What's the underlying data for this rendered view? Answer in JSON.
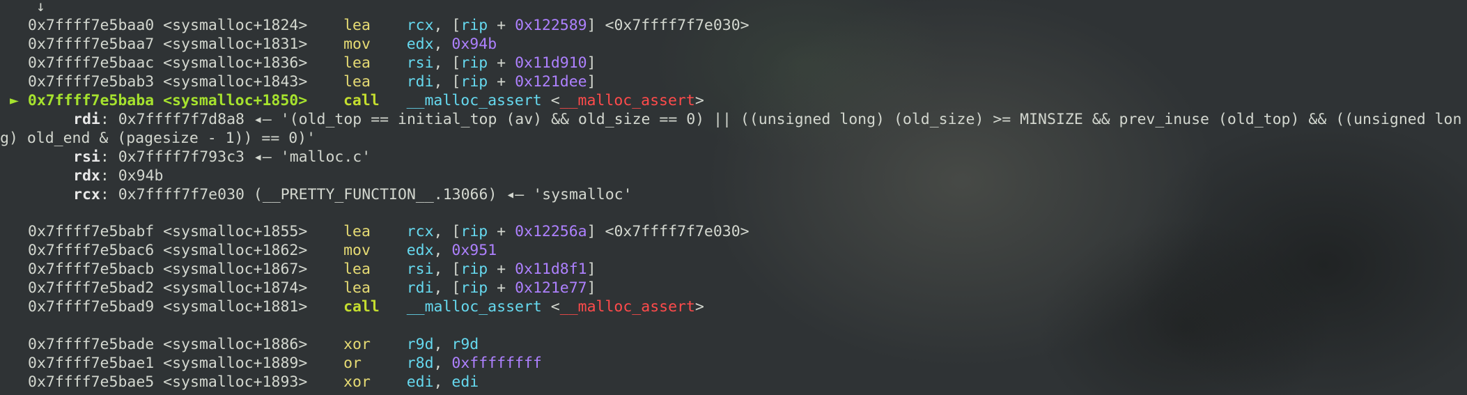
{
  "terminal": {
    "branch_arrow": "↓",
    "block1": [
      {
        "addr": "0x7ffff7e5baa0",
        "sym": "<sysmalloc+1824>",
        "mnemonic": "lea",
        "op_reg": "rcx",
        "op_base": "rip",
        "op_imm": "0x122589",
        "comment": " <0x7ffff7f7e030>"
      },
      {
        "addr": "0x7ffff7e5baa7",
        "sym": "<sysmalloc+1831>",
        "mnemonic": "mov",
        "op_reg": "edx",
        "op_imm": "0x94b"
      },
      {
        "addr": "0x7ffff7e5baac",
        "sym": "<sysmalloc+1836>",
        "mnemonic": "lea",
        "op_reg": "rsi",
        "op_base": "rip",
        "op_imm": "0x11d910"
      },
      {
        "addr": "0x7ffff7e5bab3",
        "sym": "<sysmalloc+1843>",
        "mnemonic": "lea",
        "op_reg": "rdi",
        "op_base": "rip",
        "op_imm": "0x121dee"
      }
    ],
    "current": {
      "marker": "►",
      "addr": "0x7ffff7e5baba",
      "sym": "<sysmalloc+1850>",
      "mnemonic": "call",
      "target": "__malloc_assert",
      "target_sym": "__malloc_assert"
    },
    "args": {
      "rdi_name": "rdi",
      "rdi_value": "0x7ffff7f7d8a8",
      "rdi_string_1": "'(old_top == initial_top (av) && old_size == 0) || ((unsigned long) (old_size) >= MINSIZE && prev_inuse (old_top) && ((unsigned lon",
      "rdi_string_2": "g) old_end & (pagesize - 1)) == 0)'",
      "rsi_name": "rsi",
      "rsi_value": "0x7ffff7f793c3",
      "rsi_string": "'malloc.c'",
      "rdx_name": "rdx",
      "rdx_value": "0x94b",
      "rcx_name": "rcx",
      "rcx_value": "0x7ffff7f7e030 (__PRETTY_FUNCTION__.13066)",
      "rcx_string": "'sysmalloc'",
      "arrow": "◂—"
    },
    "block2": [
      {
        "addr": "0x7ffff7e5babf",
        "sym": "<sysmalloc+1855>",
        "mnemonic": "lea",
        "op_reg": "rcx",
        "op_base": "rip",
        "op_imm": "0x12256a",
        "comment": " <0x7ffff7f7e030>"
      },
      {
        "addr": "0x7ffff7e5bac6",
        "sym": "<sysmalloc+1862>",
        "mnemonic": "mov",
        "op_reg": "edx",
        "op_imm": "0x951"
      },
      {
        "addr": "0x7ffff7e5bacb",
        "sym": "<sysmalloc+1867>",
        "mnemonic": "lea",
        "op_reg": "rsi",
        "op_base": "rip",
        "op_imm": "0x11d8f1"
      },
      {
        "addr": "0x7ffff7e5bad2",
        "sym": "<sysmalloc+1874>",
        "mnemonic": "lea",
        "op_reg": "rdi",
        "op_base": "rip",
        "op_imm": "0x121e77"
      }
    ],
    "call2": {
      "addr": "0x7ffff7e5bad9",
      "sym": "<sysmalloc+1881>",
      "mnemonic": "call",
      "target": "__malloc_assert",
      "target_sym": "__malloc_assert"
    },
    "block3": [
      {
        "addr": "0x7ffff7e5bade",
        "sym": "<sysmalloc+1886>",
        "mnemonic": "xor",
        "op_a": "r9d",
        "op_b": "r9d",
        "op_b_kind": "reg"
      },
      {
        "addr": "0x7ffff7e5bae1",
        "sym": "<sysmalloc+1889>",
        "mnemonic": "or",
        "op_a": "r8d",
        "op_b": "0xffffffff",
        "op_b_kind": "imm"
      },
      {
        "addr": "0x7ffff7e5bae5",
        "sym": "<sysmalloc+1893>",
        "mnemonic": "xor",
        "op_a": "edi",
        "op_b": "edi",
        "op_b_kind": "reg"
      }
    ]
  }
}
